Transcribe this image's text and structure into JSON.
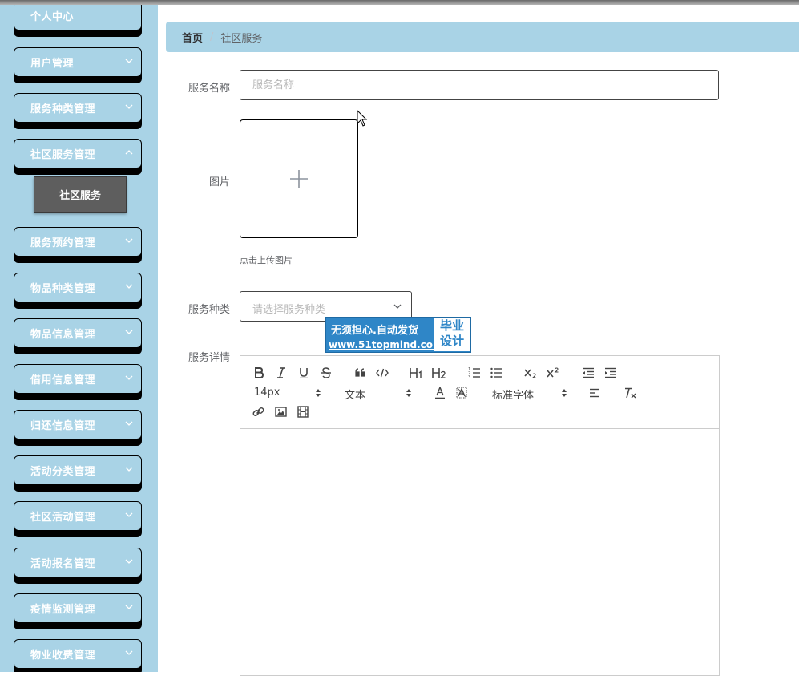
{
  "sidebar": {
    "items": [
      {
        "label": "个人中心"
      },
      {
        "label": "用户管理"
      },
      {
        "label": "服务种类管理"
      },
      {
        "label": "社区服务管理"
      },
      {
        "label": "服务预约管理"
      },
      {
        "label": "物品种类管理"
      },
      {
        "label": "物品信息管理"
      },
      {
        "label": "借用信息管理"
      },
      {
        "label": "归还信息管理"
      },
      {
        "label": "活动分类管理"
      },
      {
        "label": "社区活动管理"
      },
      {
        "label": "活动报名管理"
      },
      {
        "label": "疫情监测管理"
      },
      {
        "label": "物业收费管理"
      }
    ],
    "active_sub": "社区服务"
  },
  "breadcrumb": {
    "home": "首页",
    "separator": "/",
    "current": "社区服务"
  },
  "form": {
    "name_label": "服务名称",
    "name_placeholder": "服务名称",
    "name_value": "",
    "image_label": "图片",
    "upload_tip": "点击上传图片",
    "type_label": "服务种类",
    "type_placeholder": "请选择服务种类",
    "detail_label": "服务详情"
  },
  "editor": {
    "font_size": "14px",
    "header_picker": "文本",
    "font_picker": "标准字体"
  },
  "watermark": {
    "line1": "无须担心.自动发货",
    "line2": "www.51topmind.com",
    "badge_line1": "毕业",
    "badge_line2": "设计"
  },
  "colors": {
    "sidebar_bg": "#a9d3e6",
    "submenu_bg": "#5e5e5e",
    "watermark_bg": "#2f86c7"
  }
}
